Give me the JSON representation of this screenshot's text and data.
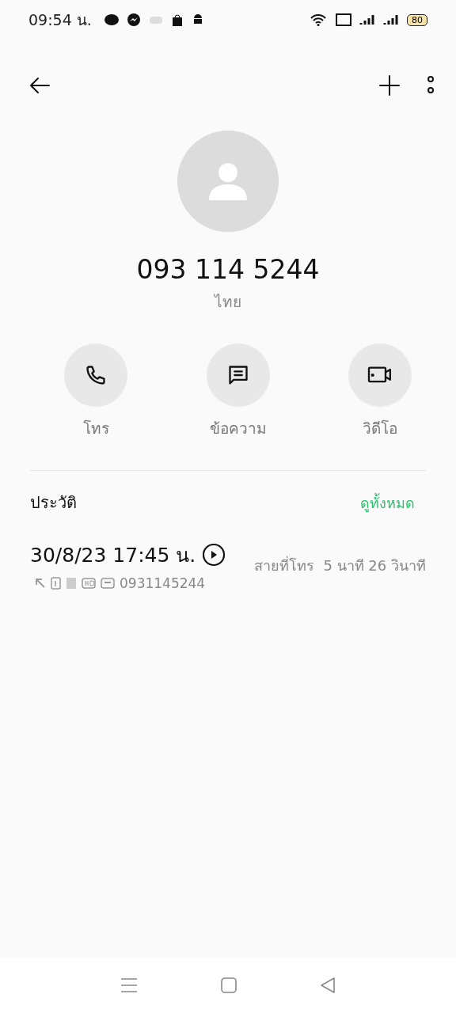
{
  "status_bar": {
    "time": "09:54 น.",
    "battery": "80"
  },
  "contact": {
    "number": "093 114 5244",
    "location": "ไทย"
  },
  "actions": [
    {
      "kind": "call",
      "label": "โทร"
    },
    {
      "kind": "message",
      "label": "ข้อความ"
    },
    {
      "kind": "video",
      "label": "วิดีโอ"
    }
  ],
  "history": {
    "title": "ประวัติ",
    "see_all": "ดูทั้งหมด",
    "entries": [
      {
        "datetime": "30/8/23 17:45 น.",
        "number": "0931145244",
        "duration": "สายที่โทร  5 นาที 26 วินาที"
      }
    ]
  }
}
